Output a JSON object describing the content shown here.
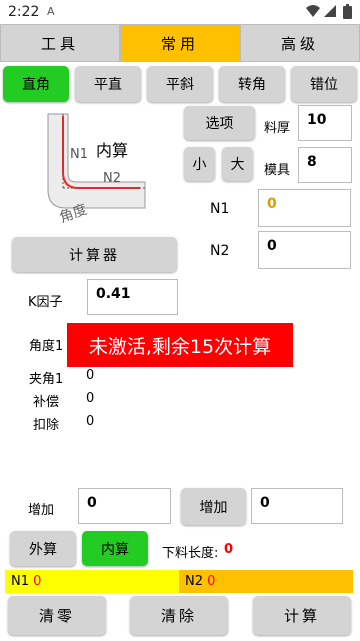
{
  "status": {
    "time": "2:22"
  },
  "top_tabs": [
    {
      "label": "工具"
    },
    {
      "label": "常用"
    },
    {
      "label": "高级"
    }
  ],
  "sub_tabs": [
    {
      "label": "直角"
    },
    {
      "label": "平直"
    },
    {
      "label": "平斜"
    },
    {
      "label": "转角"
    },
    {
      "label": "错位"
    }
  ],
  "diagram": {
    "n1": "N1",
    "n2": "N2",
    "inner": "内算",
    "angle": "角度"
  },
  "options_button": "选项",
  "small_button": "小",
  "large_button": "大",
  "thickness": {
    "label": "料厚",
    "value": "10"
  },
  "die": {
    "label": "模具",
    "value": "8"
  },
  "n1": {
    "label": "N1",
    "value": "0"
  },
  "n2": {
    "label": "N2",
    "value": "0"
  },
  "calculator_button": "计算器",
  "k_factor": {
    "label": "K因子",
    "value": "0.41"
  },
  "angle1_label": "角度1",
  "banner": "未激活,剩余15次计算",
  "results": [
    {
      "label": "夹角1",
      "value": "0"
    },
    {
      "label": "补偿",
      "value": "0"
    },
    {
      "label": "扣除",
      "value": "0"
    }
  ],
  "add_left": {
    "label": "增加",
    "value": "0"
  },
  "add_right": {
    "label": "增加",
    "value": "0"
  },
  "outer_button": "外算",
  "inner_button": "内算",
  "blank_length": {
    "label": "下料长度:",
    "value": "0"
  },
  "bar_n1": {
    "label": "N1",
    "value": "0"
  },
  "bar_n2": {
    "label": "N2",
    "value": "0"
  },
  "clear_zero_button": "清零",
  "clear_button": "清除",
  "calculate_button": "计算"
}
